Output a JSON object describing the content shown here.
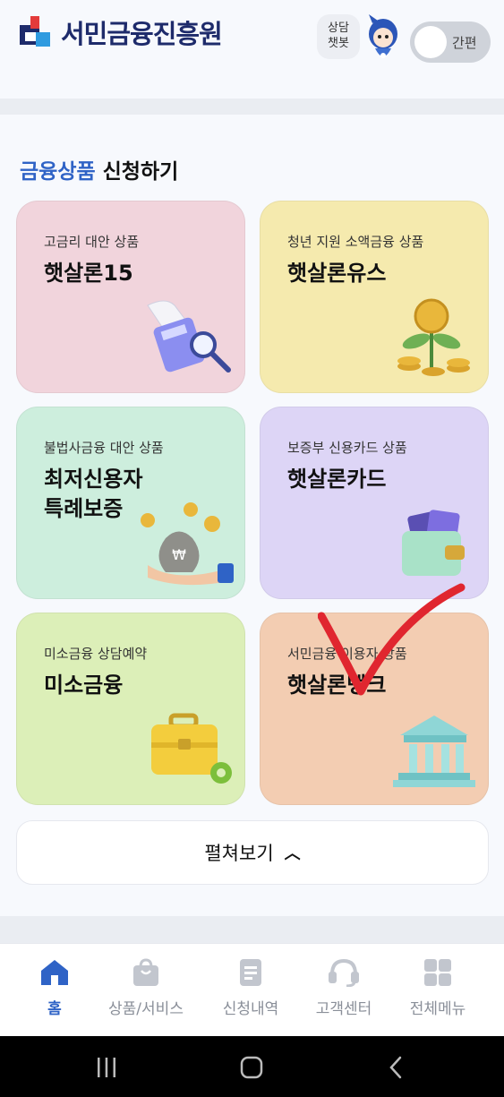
{
  "header": {
    "logo_text": "서민금융진흥원",
    "chatbot_label": "상담\n챗봇",
    "toggle_label": "간편"
  },
  "section": {
    "title_accent": "금융상품",
    "title_rest": " 신청하기",
    "expand_label": "펼쳐보기",
    "cards": [
      {
        "subtitle": "고금리 대안 상품",
        "title": "햇살론15",
        "icon": "calculator-magnifier-icon"
      },
      {
        "subtitle": "청년 지원 소액금융 상품",
        "title": "햇살론유스",
        "icon": "coin-plant-icon"
      },
      {
        "subtitle": "불법사금융 대안 상품",
        "title": "최저신용자\n특례보증",
        "icon": "money-bag-hand-icon"
      },
      {
        "subtitle": "보증부 신용카드 상품",
        "title": "햇살론카드",
        "icon": "wallet-cards-icon"
      },
      {
        "subtitle": "미소금융 상담예약",
        "title": "미소금융",
        "icon": "briefcase-gear-icon"
      },
      {
        "subtitle": "서민금융 이용자 상품",
        "title": "햇살론뱅크",
        "icon": "bank-building-icon"
      }
    ]
  },
  "nav": {
    "items": [
      {
        "label": "홈",
        "icon": "home-icon",
        "active": true
      },
      {
        "label": "상품/서비스",
        "icon": "shopping-bag-icon"
      },
      {
        "label": "신청내역",
        "icon": "document-icon"
      },
      {
        "label": "고객센터",
        "icon": "headset-icon"
      },
      {
        "label": "전체메뉴",
        "icon": "grid-menu-icon"
      }
    ]
  },
  "colors": {
    "accent": "#2f63c6",
    "check_mark": "#e0262f"
  }
}
